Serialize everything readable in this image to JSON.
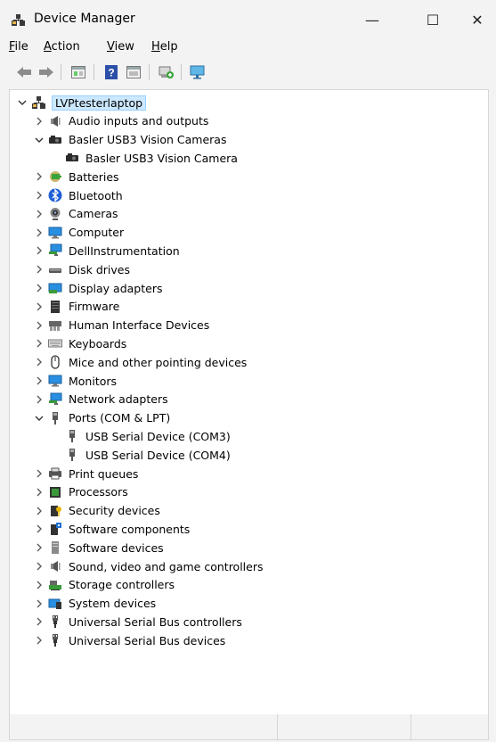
{
  "window": {
    "title": "Device Manager",
    "minimize": "—",
    "maximize": "☐",
    "close": "✕"
  },
  "menu": [
    {
      "label": "File",
      "acc": "F",
      "rest": "ile"
    },
    {
      "label": "Action",
      "acc": "A",
      "rest": "ction"
    },
    {
      "label": "View",
      "acc": "V",
      "rest": "iew"
    },
    {
      "label": "Help",
      "acc": "H",
      "rest": "elp"
    }
  ],
  "toolbar": [
    "back-icon",
    "forward-icon",
    "properties-icon",
    "help-icon",
    "driver-view-icon",
    "update-driver-icon",
    "scan-hardware-icon"
  ],
  "tree": {
    "root": "LVPtesterlaptop",
    "nodes": [
      {
        "label": "Audio inputs and outputs",
        "icon": "speaker-icon",
        "expanded": false,
        "children": []
      },
      {
        "label": "Basler USB3 Vision Cameras",
        "icon": "camera-device-icon",
        "expanded": true,
        "children": [
          {
            "label": "Basler USB3 Vision Camera",
            "icon": "camera-device-icon"
          }
        ]
      },
      {
        "label": "Batteries",
        "icon": "battery-icon",
        "expanded": false,
        "children": []
      },
      {
        "label": "Bluetooth",
        "icon": "bluetooth-icon",
        "expanded": false,
        "children": []
      },
      {
        "label": "Cameras",
        "icon": "webcam-icon",
        "expanded": false,
        "children": []
      },
      {
        "label": "Computer",
        "icon": "monitor-icon",
        "expanded": false,
        "children": []
      },
      {
        "label": "DellInstrumentation",
        "icon": "network-monitor-icon",
        "expanded": false,
        "children": []
      },
      {
        "label": "Disk drives",
        "icon": "disk-drive-icon",
        "expanded": false,
        "children": []
      },
      {
        "label": "Display adapters",
        "icon": "display-adapter-icon",
        "expanded": false,
        "children": []
      },
      {
        "label": "Firmware",
        "icon": "firmware-icon",
        "expanded": false,
        "children": []
      },
      {
        "label": "Human Interface Devices",
        "icon": "hid-icon",
        "expanded": false,
        "children": []
      },
      {
        "label": "Keyboards",
        "icon": "keyboard-icon",
        "expanded": false,
        "children": []
      },
      {
        "label": "Mice and other pointing devices",
        "icon": "mouse-icon",
        "expanded": false,
        "children": []
      },
      {
        "label": "Monitors",
        "icon": "monitor-icon",
        "expanded": false,
        "children": []
      },
      {
        "label": "Network adapters",
        "icon": "network-monitor-icon",
        "expanded": false,
        "children": []
      },
      {
        "label": "Ports (COM & LPT)",
        "icon": "port-icon",
        "expanded": true,
        "children": [
          {
            "label": "USB Serial Device (COM3)",
            "icon": "port-icon"
          },
          {
            "label": "USB Serial Device (COM4)",
            "icon": "port-icon"
          }
        ]
      },
      {
        "label": "Print queues",
        "icon": "printer-icon",
        "expanded": false,
        "children": []
      },
      {
        "label": "Processors",
        "icon": "processor-icon",
        "expanded": false,
        "children": []
      },
      {
        "label": "Security devices",
        "icon": "security-device-icon",
        "expanded": false,
        "children": []
      },
      {
        "label": "Software components",
        "icon": "software-component-icon",
        "expanded": false,
        "children": []
      },
      {
        "label": "Software devices",
        "icon": "software-device-icon",
        "expanded": false,
        "children": []
      },
      {
        "label": "Sound, video and game controllers",
        "icon": "speaker-icon",
        "expanded": false,
        "children": []
      },
      {
        "label": "Storage controllers",
        "icon": "storage-controller-icon",
        "expanded": false,
        "children": []
      },
      {
        "label": "System devices",
        "icon": "system-devices-icon",
        "expanded": false,
        "children": []
      },
      {
        "label": "Universal Serial Bus controllers",
        "icon": "usb-icon",
        "expanded": false,
        "children": []
      },
      {
        "label": "Universal Serial Bus devices",
        "icon": "usb-icon",
        "expanded": false,
        "children": []
      }
    ]
  }
}
